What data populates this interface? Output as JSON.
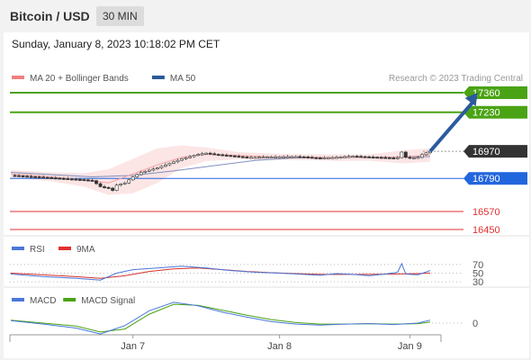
{
  "header": {
    "title": "Bitcoin / USD",
    "timeframe": "30 MIN",
    "timestamp": "Sunday, January 8, 2023 10:18:02 PM CET"
  },
  "chart_data": [
    {
      "type": "line",
      "panel": "price",
      "legend": [
        {
          "label": "MA 20 + Bollinger Bands",
          "color": "#f08080"
        },
        {
          "label": "MA 50",
          "color": "#2a5a9a"
        }
      ],
      "copyright": "Research © 2023 Trading Central",
      "ylim": [
        16420,
        17390
      ],
      "levels": [
        {
          "value": 17360,
          "label": "17360",
          "color": "#4aa314",
          "type": "target"
        },
        {
          "value": 17230,
          "label": "17230",
          "color": "#4aa314",
          "type": "target"
        },
        {
          "value": 16970,
          "label": "16970",
          "color": "#333333",
          "type": "last-price"
        },
        {
          "value": 16790,
          "label": "16790",
          "color": "#2266dd",
          "type": "pivot"
        },
        {
          "value": 16570,
          "label": "16570",
          "color": "#e03030",
          "type": "support"
        },
        {
          "value": 16450,
          "label": "16450",
          "color": "#e03030",
          "type": "support"
        }
      ],
      "price_path": [
        [
          0,
          16810
        ],
        [
          3,
          16805
        ],
        [
          6,
          16800
        ],
        [
          9,
          16795
        ],
        [
          12,
          16790
        ],
        [
          15,
          16785
        ],
        [
          18,
          16780
        ],
        [
          20,
          16775
        ],
        [
          22,
          16735
        ],
        [
          24,
          16725
        ],
        [
          25,
          16710
        ],
        [
          26,
          16745
        ],
        [
          28,
          16760
        ],
        [
          30,
          16800
        ],
        [
          32,
          16830
        ],
        [
          34,
          16845
        ],
        [
          36,
          16860
        ],
        [
          38,
          16880
        ],
        [
          40,
          16900
        ],
        [
          42,
          16920
        ],
        [
          44,
          16935
        ],
        [
          46,
          16950
        ],
        [
          48,
          16958
        ],
        [
          50,
          16950
        ],
        [
          52,
          16945
        ],
        [
          54,
          16940
        ],
        [
          56,
          16935
        ],
        [
          58,
          16930
        ],
        [
          60,
          16930
        ],
        [
          62,
          16932
        ],
        [
          64,
          16933
        ],
        [
          66,
          16934
        ],
        [
          68,
          16935
        ],
        [
          70,
          16935
        ],
        [
          72,
          16933
        ],
        [
          74,
          16928
        ],
        [
          76,
          16925
        ],
        [
          78,
          16928
        ],
        [
          80,
          16930
        ],
        [
          82,
          16935
        ],
        [
          84,
          16938
        ],
        [
          86,
          16935
        ],
        [
          88,
          16932
        ],
        [
          90,
          16930
        ],
        [
          92,
          16928
        ],
        [
          94,
          16925
        ],
        [
          95,
          16928
        ],
        [
          96,
          16965
        ],
        [
          97,
          16930
        ],
        [
          98,
          16925
        ],
        [
          100,
          16930
        ],
        [
          101,
          16948
        ],
        [
          102,
          16960
        ],
        [
          103,
          16970
        ]
      ],
      "ma50_path": [
        [
          0,
          16830
        ],
        [
          10,
          16815
        ],
        [
          20,
          16800
        ],
        [
          30,
          16810
        ],
        [
          40,
          16840
        ],
        [
          50,
          16875
        ],
        [
          60,
          16910
        ],
        [
          70,
          16927
        ],
        [
          80,
          16928
        ],
        [
          90,
          16930
        ],
        [
          103,
          16935
        ]
      ],
      "ma20_path": [
        [
          0,
          16820
        ],
        [
          10,
          16800
        ],
        [
          18,
          16780
        ],
        [
          24,
          16760
        ],
        [
          30,
          16820
        ],
        [
          36,
          16880
        ],
        [
          42,
          16930
        ],
        [
          48,
          16950
        ],
        [
          56,
          16942
        ],
        [
          64,
          16933
        ],
        [
          72,
          16932
        ],
        [
          80,
          16928
        ],
        [
          88,
          16930
        ],
        [
          96,
          16932
        ],
        [
          103,
          16945
        ]
      ],
      "bb_upper": [
        [
          0,
          16845
        ],
        [
          10,
          16830
        ],
        [
          18,
          16825
        ],
        [
          24,
          16850
        ],
        [
          30,
          16920
        ],
        [
          36,
          16990
        ],
        [
          42,
          17010
        ],
        [
          48,
          16995
        ],
        [
          56,
          16965
        ],
        [
          64,
          16955
        ],
        [
          72,
          16950
        ],
        [
          80,
          16950
        ],
        [
          88,
          16950
        ],
        [
          96,
          16975
        ],
        [
          103,
          16990
        ]
      ],
      "bb_lower": [
        [
          0,
          16795
        ],
        [
          10,
          16770
        ],
        [
          18,
          16735
        ],
        [
          24,
          16680
        ],
        [
          30,
          16690
        ],
        [
          36,
          16760
        ],
        [
          42,
          16860
        ],
        [
          48,
          16905
        ],
        [
          56,
          16918
        ],
        [
          64,
          16912
        ],
        [
          72,
          16912
        ],
        [
          80,
          16906
        ],
        [
          88,
          16908
        ],
        [
          96,
          16890
        ],
        [
          103,
          16900
        ]
      ],
      "projection": [
        [
          103,
          16970
        ],
        [
          108,
          17360
        ]
      ]
    },
    {
      "type": "line",
      "panel": "rsi",
      "legend": [
        {
          "label": "RSI",
          "color": "#4a78d8"
        },
        {
          "label": "9MA",
          "color": "#e03030"
        }
      ],
      "ylim": [
        20,
        80
      ],
      "levels": [
        70,
        50,
        30
      ],
      "level_labels": [
        "70",
        "50",
        "30"
      ],
      "rsi_path": [
        [
          0,
          48
        ],
        [
          8,
          42
        ],
        [
          16,
          38
        ],
        [
          22,
          34
        ],
        [
          26,
          50
        ],
        [
          30,
          58
        ],
        [
          36,
          62
        ],
        [
          42,
          66
        ],
        [
          48,
          62
        ],
        [
          54,
          56
        ],
        [
          60,
          52
        ],
        [
          66,
          50
        ],
        [
          72,
          47
        ],
        [
          76,
          45
        ],
        [
          80,
          49
        ],
        [
          84,
          47
        ],
        [
          88,
          44
        ],
        [
          92,
          48
        ],
        [
          95,
          52
        ],
        [
          96,
          72
        ],
        [
          97,
          48
        ],
        [
          100,
          46
        ],
        [
          103,
          56
        ]
      ],
      "ma_path": [
        [
          0,
          50
        ],
        [
          8,
          46
        ],
        [
          16,
          42
        ],
        [
          22,
          38
        ],
        [
          28,
          44
        ],
        [
          34,
          54
        ],
        [
          40,
          60
        ],
        [
          46,
          62
        ],
        [
          52,
          58
        ],
        [
          58,
          54
        ],
        [
          64,
          51
        ],
        [
          70,
          49
        ],
        [
          76,
          47
        ],
        [
          82,
          47
        ],
        [
          88,
          47
        ],
        [
          94,
          48
        ],
        [
          100,
          49
        ],
        [
          103,
          50
        ]
      ]
    },
    {
      "type": "line",
      "panel": "macd",
      "legend": [
        {
          "label": "MACD",
          "color": "#4a78d8"
        },
        {
          "label": "MACD Signal",
          "color": "#4aa314"
        }
      ],
      "ylim": [
        -60,
        60
      ],
      "zero_label": "0",
      "macd_path": [
        [
          0,
          5
        ],
        [
          8,
          -2
        ],
        [
          16,
          -10
        ],
        [
          22,
          -22
        ],
        [
          28,
          -5
        ],
        [
          34,
          25
        ],
        [
          40,
          42
        ],
        [
          46,
          35
        ],
        [
          52,
          22
        ],
        [
          58,
          12
        ],
        [
          64,
          3
        ],
        [
          70,
          -2
        ],
        [
          76,
          -4
        ],
        [
          82,
          -2
        ],
        [
          88,
          -1
        ],
        [
          94,
          -3
        ],
        [
          100,
          0
        ],
        [
          103,
          6
        ]
      ],
      "signal_path": [
        [
          0,
          6
        ],
        [
          8,
          0
        ],
        [
          16,
          -6
        ],
        [
          22,
          -18
        ],
        [
          28,
          -12
        ],
        [
          34,
          18
        ],
        [
          40,
          38
        ],
        [
          46,
          36
        ],
        [
          52,
          26
        ],
        [
          58,
          16
        ],
        [
          64,
          7
        ],
        [
          70,
          1
        ],
        [
          76,
          -2
        ],
        [
          82,
          -2
        ],
        [
          88,
          -1
        ],
        [
          94,
          -2
        ],
        [
          100,
          -1
        ],
        [
          103,
          2
        ]
      ]
    }
  ],
  "xaxis": {
    "ticks": [
      {
        "label": "Jan 7",
        "bar": 30
      },
      {
        "label": "Jan 8",
        "bar": 66
      },
      {
        "label": "Jan 9",
        "bar": 98
      }
    ]
  }
}
